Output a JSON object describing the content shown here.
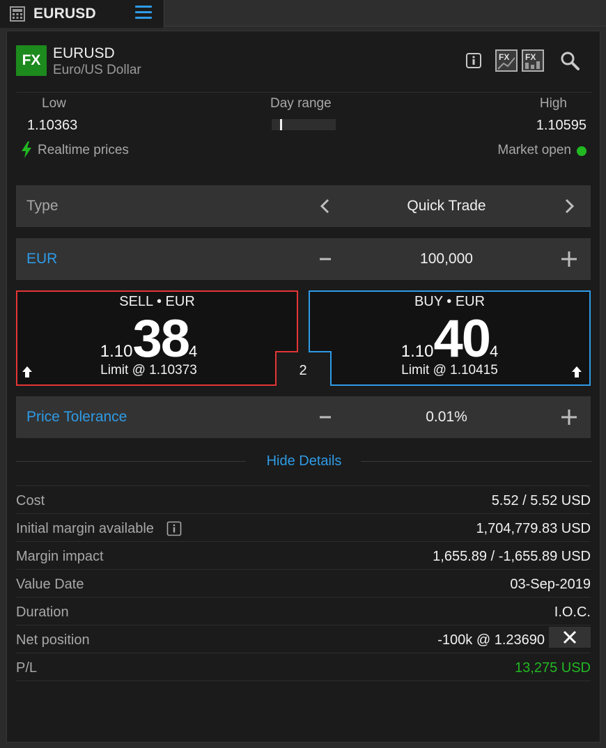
{
  "tab": {
    "title": "EURUSD"
  },
  "instrument": {
    "badge": "FX",
    "symbol": "EURUSD",
    "description": "Euro/US Dollar"
  },
  "range": {
    "low_label": "Low",
    "low_value": "1.10363",
    "mid_label": "Day range",
    "high_label": "High",
    "high_value": "1.10595",
    "marker_fraction": 0.13
  },
  "status": {
    "realtime_label": "Realtime prices",
    "market_label": "Market open"
  },
  "type_row": {
    "label": "Type",
    "value": "Quick Trade"
  },
  "amount_row": {
    "label": "EUR",
    "value": "100,000"
  },
  "sell": {
    "title": "SELL • EUR",
    "prefix": "1.10",
    "big": "38",
    "pip": "4",
    "limit": "Limit @ 1.10373",
    "color": "#e53535"
  },
  "buy": {
    "title": "BUY • EUR",
    "prefix": "1.10",
    "big": "40",
    "pip": "4",
    "limit": "Limit @ 1.10415",
    "color": "#2f9be6"
  },
  "spread": "2",
  "tolerance_row": {
    "label": "Price Tolerance",
    "value": "0.01%"
  },
  "hide_details": "Hide Details",
  "details": {
    "cost_label": "Cost",
    "cost_value": "5.52 / 5.52 USD",
    "margin_label": "Initial margin available",
    "margin_value": "1,704,779.83 USD",
    "impact_label": "Margin impact",
    "impact_value": "1,655.89 / -1,655.89 USD",
    "date_label": "Value Date",
    "date_value": "03-Sep-2019",
    "duration_label": "Duration",
    "duration_value": "I.O.C.",
    "position_label": "Net position",
    "position_value": "-100k @ 1.23690",
    "pl_label": "P/L",
    "pl_value": "13,275 USD"
  },
  "colors": {
    "accent": "#2f9be6",
    "positive": "#22b822",
    "sell": "#e53535",
    "buy": "#2f9be6"
  }
}
